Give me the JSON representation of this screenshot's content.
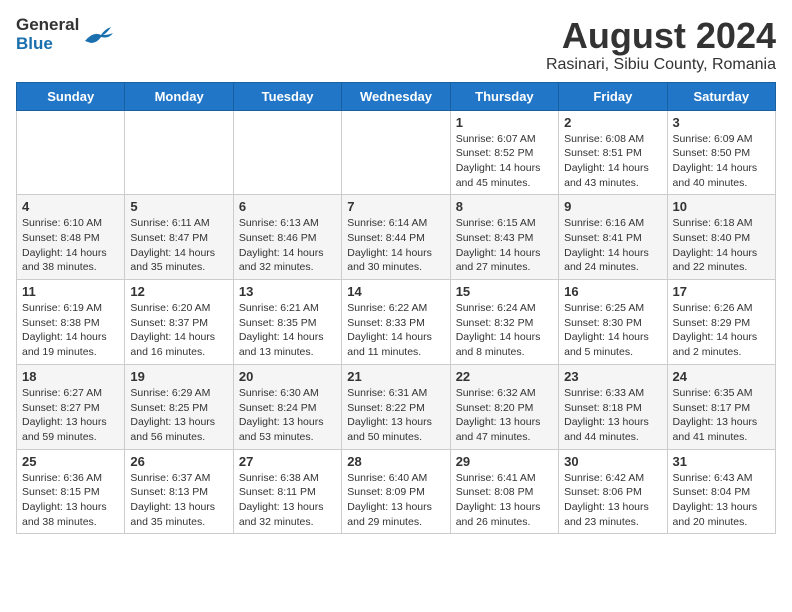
{
  "header": {
    "logo": {
      "general": "General",
      "blue": "Blue"
    },
    "month_year": "August 2024",
    "location": "Rasinari, Sibiu County, Romania"
  },
  "days_of_week": [
    "Sunday",
    "Monday",
    "Tuesday",
    "Wednesday",
    "Thursday",
    "Friday",
    "Saturday"
  ],
  "weeks": [
    [
      {
        "day": "",
        "info": ""
      },
      {
        "day": "",
        "info": ""
      },
      {
        "day": "",
        "info": ""
      },
      {
        "day": "",
        "info": ""
      },
      {
        "day": "1",
        "info": "Sunrise: 6:07 AM\nSunset: 8:52 PM\nDaylight: 14 hours and 45 minutes."
      },
      {
        "day": "2",
        "info": "Sunrise: 6:08 AM\nSunset: 8:51 PM\nDaylight: 14 hours and 43 minutes."
      },
      {
        "day": "3",
        "info": "Sunrise: 6:09 AM\nSunset: 8:50 PM\nDaylight: 14 hours and 40 minutes."
      }
    ],
    [
      {
        "day": "4",
        "info": "Sunrise: 6:10 AM\nSunset: 8:48 PM\nDaylight: 14 hours and 38 minutes."
      },
      {
        "day": "5",
        "info": "Sunrise: 6:11 AM\nSunset: 8:47 PM\nDaylight: 14 hours and 35 minutes."
      },
      {
        "day": "6",
        "info": "Sunrise: 6:13 AM\nSunset: 8:46 PM\nDaylight: 14 hours and 32 minutes."
      },
      {
        "day": "7",
        "info": "Sunrise: 6:14 AM\nSunset: 8:44 PM\nDaylight: 14 hours and 30 minutes."
      },
      {
        "day": "8",
        "info": "Sunrise: 6:15 AM\nSunset: 8:43 PM\nDaylight: 14 hours and 27 minutes."
      },
      {
        "day": "9",
        "info": "Sunrise: 6:16 AM\nSunset: 8:41 PM\nDaylight: 14 hours and 24 minutes."
      },
      {
        "day": "10",
        "info": "Sunrise: 6:18 AM\nSunset: 8:40 PM\nDaylight: 14 hours and 22 minutes."
      }
    ],
    [
      {
        "day": "11",
        "info": "Sunrise: 6:19 AM\nSunset: 8:38 PM\nDaylight: 14 hours and 19 minutes."
      },
      {
        "day": "12",
        "info": "Sunrise: 6:20 AM\nSunset: 8:37 PM\nDaylight: 14 hours and 16 minutes."
      },
      {
        "day": "13",
        "info": "Sunrise: 6:21 AM\nSunset: 8:35 PM\nDaylight: 14 hours and 13 minutes."
      },
      {
        "day": "14",
        "info": "Sunrise: 6:22 AM\nSunset: 8:33 PM\nDaylight: 14 hours and 11 minutes."
      },
      {
        "day": "15",
        "info": "Sunrise: 6:24 AM\nSunset: 8:32 PM\nDaylight: 14 hours and 8 minutes."
      },
      {
        "day": "16",
        "info": "Sunrise: 6:25 AM\nSunset: 8:30 PM\nDaylight: 14 hours and 5 minutes."
      },
      {
        "day": "17",
        "info": "Sunrise: 6:26 AM\nSunset: 8:29 PM\nDaylight: 14 hours and 2 minutes."
      }
    ],
    [
      {
        "day": "18",
        "info": "Sunrise: 6:27 AM\nSunset: 8:27 PM\nDaylight: 13 hours and 59 minutes."
      },
      {
        "day": "19",
        "info": "Sunrise: 6:29 AM\nSunset: 8:25 PM\nDaylight: 13 hours and 56 minutes."
      },
      {
        "day": "20",
        "info": "Sunrise: 6:30 AM\nSunset: 8:24 PM\nDaylight: 13 hours and 53 minutes."
      },
      {
        "day": "21",
        "info": "Sunrise: 6:31 AM\nSunset: 8:22 PM\nDaylight: 13 hours and 50 minutes."
      },
      {
        "day": "22",
        "info": "Sunrise: 6:32 AM\nSunset: 8:20 PM\nDaylight: 13 hours and 47 minutes."
      },
      {
        "day": "23",
        "info": "Sunrise: 6:33 AM\nSunset: 8:18 PM\nDaylight: 13 hours and 44 minutes."
      },
      {
        "day": "24",
        "info": "Sunrise: 6:35 AM\nSunset: 8:17 PM\nDaylight: 13 hours and 41 minutes."
      }
    ],
    [
      {
        "day": "25",
        "info": "Sunrise: 6:36 AM\nSunset: 8:15 PM\nDaylight: 13 hours and 38 minutes."
      },
      {
        "day": "26",
        "info": "Sunrise: 6:37 AM\nSunset: 8:13 PM\nDaylight: 13 hours and 35 minutes."
      },
      {
        "day": "27",
        "info": "Sunrise: 6:38 AM\nSunset: 8:11 PM\nDaylight: 13 hours and 32 minutes."
      },
      {
        "day": "28",
        "info": "Sunrise: 6:40 AM\nSunset: 8:09 PM\nDaylight: 13 hours and 29 minutes."
      },
      {
        "day": "29",
        "info": "Sunrise: 6:41 AM\nSunset: 8:08 PM\nDaylight: 13 hours and 26 minutes."
      },
      {
        "day": "30",
        "info": "Sunrise: 6:42 AM\nSunset: 8:06 PM\nDaylight: 13 hours and 23 minutes."
      },
      {
        "day": "31",
        "info": "Sunrise: 6:43 AM\nSunset: 8:04 PM\nDaylight: 13 hours and 20 minutes."
      }
    ]
  ]
}
